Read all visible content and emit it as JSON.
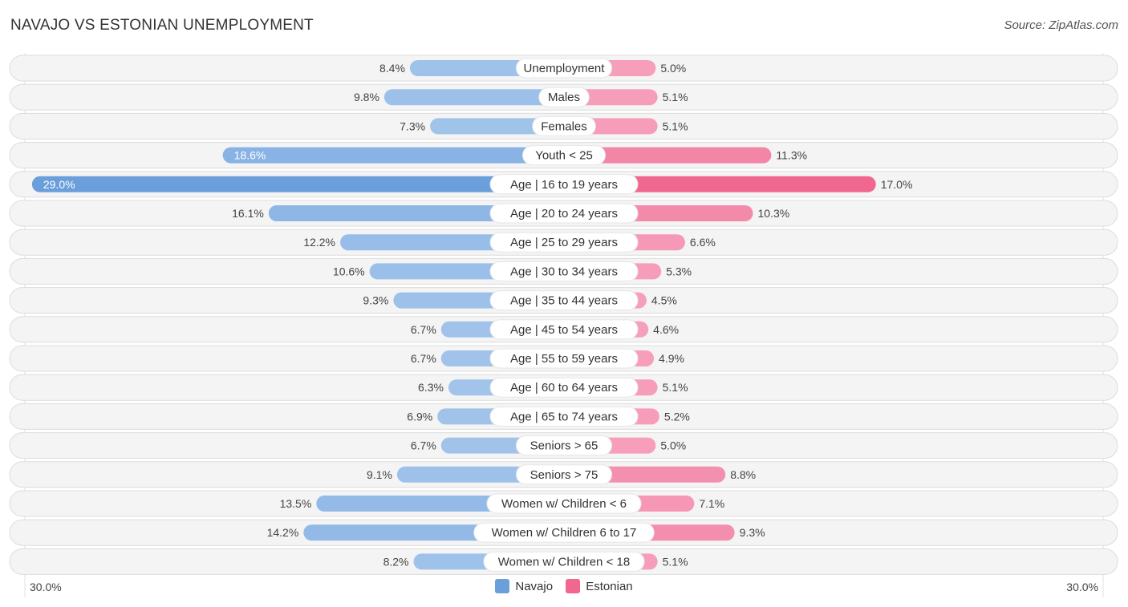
{
  "header": {
    "title": "NAVAJO VS ESTONIAN UNEMPLOYMENT",
    "source": "Source: ZipAtlas.com"
  },
  "colors": {
    "navajo": "#6a9fdc",
    "navajo_light": "#a8c8ec",
    "estonian": "#f06890",
    "estonian_light": "#f7a8c2"
  },
  "chart_data": {
    "type": "bar",
    "orientation": "horizontal-diverging",
    "title": "NAVAJO VS ESTONIAN UNEMPLOYMENT",
    "categories": [
      "Unemployment",
      "Males",
      "Females",
      "Youth < 25",
      "Age | 16 to 19 years",
      "Age | 20 to 24 years",
      "Age | 25 to 29 years",
      "Age | 30 to 34 years",
      "Age | 35 to 44 years",
      "Age | 45 to 54 years",
      "Age | 55 to 59 years",
      "Age | 60 to 64 years",
      "Age | 65 to 74 years",
      "Seniors > 65",
      "Seniors > 75",
      "Women w/ Children < 6",
      "Women w/ Children 6 to 17",
      "Women w/ Children < 18"
    ],
    "series": [
      {
        "name": "Navajo",
        "side": "left",
        "values": [
          8.4,
          9.8,
          7.3,
          18.6,
          29.0,
          16.1,
          12.2,
          10.6,
          9.3,
          6.7,
          6.7,
          6.3,
          6.9,
          6.7,
          9.1,
          13.5,
          14.2,
          8.2
        ]
      },
      {
        "name": "Estonian",
        "side": "right",
        "values": [
          5.0,
          5.1,
          5.1,
          11.3,
          17.0,
          10.3,
          6.6,
          5.3,
          4.5,
          4.6,
          4.9,
          5.1,
          5.2,
          5.0,
          8.8,
          7.1,
          9.3,
          5.1
        ]
      }
    ],
    "unit": "%",
    "xlim": [
      -30,
      30
    ],
    "axis_labels": {
      "left": "30.0%",
      "right": "30.0%"
    },
    "legend": {
      "position": "bottom-center",
      "items": [
        "Navajo",
        "Estonian"
      ]
    },
    "grid": false
  }
}
